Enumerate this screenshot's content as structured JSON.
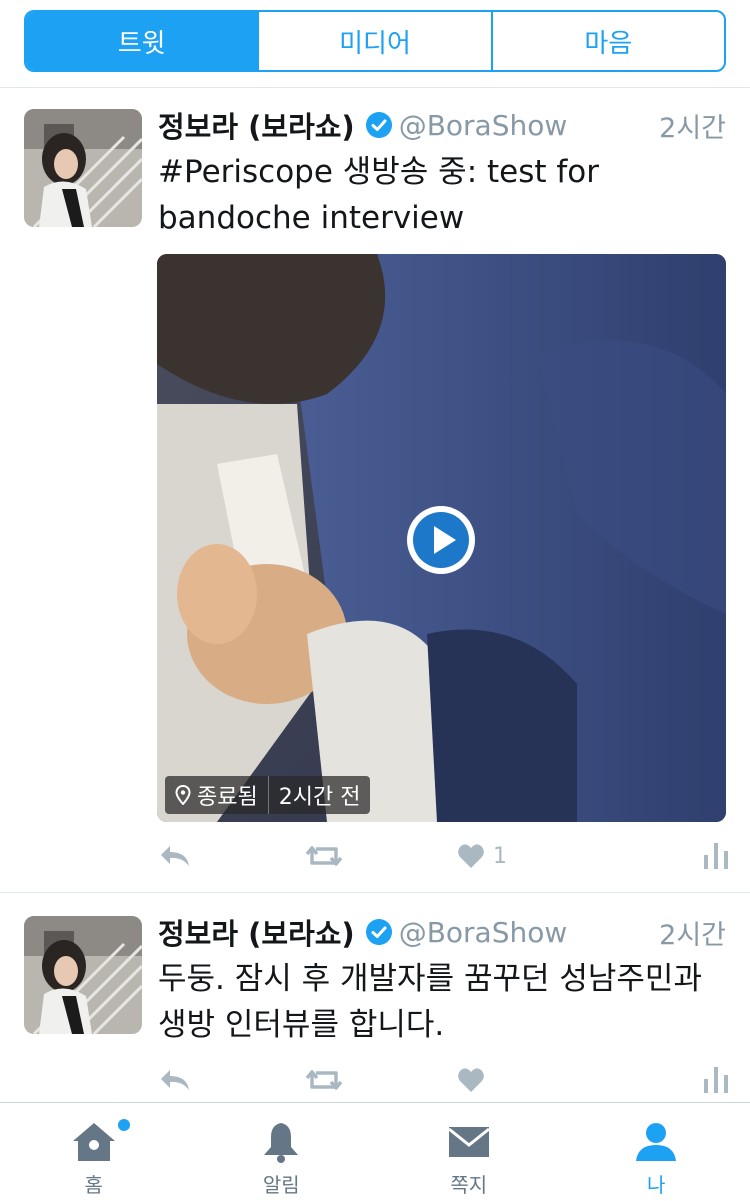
{
  "tabs": [
    {
      "label": "트윗",
      "active": true
    },
    {
      "label": "미디어",
      "active": false
    },
    {
      "label": "마음",
      "active": false
    }
  ],
  "tweets": [
    {
      "name": "정보라 (보라쇼)",
      "handle": "@BoraShow",
      "time": "2시간",
      "text": "#Periscope 생방송 중: test for bandoche interview",
      "media": {
        "status": "종료됨",
        "ago": "2시간 전",
        "play_icon": "play-icon"
      },
      "likes": "1"
    },
    {
      "name": "정보라 (보라쇼)",
      "handle": "@BoraShow",
      "time": "2시간",
      "text": "두둥. 잠시 후 개발자를 꿈꾸던 성남주민과 생방 인터뷰를 합니다.",
      "likes": ""
    }
  ],
  "bottom_nav": [
    {
      "label": "홈",
      "icon": "home-icon",
      "badge": true
    },
    {
      "label": "알림",
      "icon": "bell-icon"
    },
    {
      "label": "쪽지",
      "icon": "mail-icon"
    },
    {
      "label": "나",
      "icon": "person-icon",
      "active": true
    }
  ],
  "colors": {
    "accent": "#1da1f2",
    "muted": "#8899a6",
    "icon_gray": "#aab8c2"
  }
}
